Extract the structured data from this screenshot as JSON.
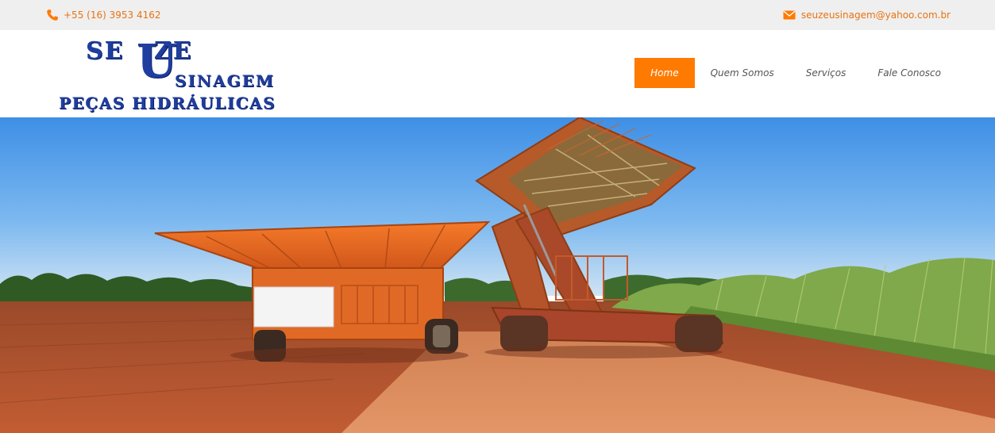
{
  "topbar": {
    "phone": "+55 (16) 3953 4162",
    "email": "seuzeusinagem@yahoo.com.br",
    "phone_icon": "phone-icon",
    "email_icon": "envelope-icon"
  },
  "logo": {
    "line1": "SE ZE",
    "letter_u": "U",
    "line2": "SINAGEM",
    "line3": "PEÇAS HIDRÁULICAS"
  },
  "nav": {
    "items": [
      {
        "label": "Home",
        "active": true
      },
      {
        "label": "Quem Somos",
        "active": false
      },
      {
        "label": "Serviços",
        "active": false
      },
      {
        "label": "Fale Conosco",
        "active": false
      }
    ]
  },
  "colors": {
    "accent": "#ff7a00",
    "contact_text": "#e87311",
    "logo_blue": "#1f3ea0",
    "topbar_bg": "#efefef"
  }
}
